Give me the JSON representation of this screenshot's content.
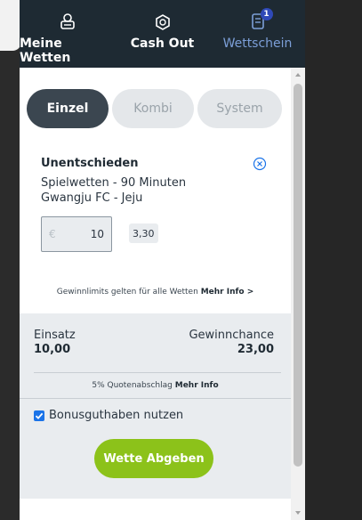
{
  "nav": {
    "tabs": [
      {
        "label": "Meine Wetten",
        "icon": "my-bets-icon"
      },
      {
        "label": "Cash Out",
        "icon": "cash-out-icon"
      },
      {
        "label": "Wettschein",
        "icon": "betslip-icon",
        "badge": "1",
        "active": true
      }
    ]
  },
  "betslip": {
    "modes": [
      "Einzel",
      "Kombi",
      "System"
    ],
    "active_mode": "Einzel",
    "selection": {
      "outcome": "Unentschieden",
      "market": "Spielwetten - 90 Minuten",
      "event": "Gwangju FC - Jeju"
    },
    "stake": {
      "currency": "€",
      "value": "10"
    },
    "odds": "3,30",
    "limits_text": "Gewinnlimits gelten für alle Wetten",
    "limits_link": "Mehr Info >"
  },
  "summary": {
    "stake_label": "Einsatz",
    "stake_value": "10,00",
    "payout_label": "Gewinnchance",
    "payout_value": "23,00",
    "quoten_text": "5% Quotenabschlag",
    "quoten_link": "Mehr Info",
    "bonus_label": "Bonusguthaben nutzen",
    "bonus_checked": true,
    "submit_label": "Wette Abgeben"
  },
  "colors": {
    "nav_bg": "#1e2a33",
    "active_tab": "#7c9fd8",
    "submit_green": "#8cc21a",
    "checkbox_blue": "#1a73e8"
  }
}
